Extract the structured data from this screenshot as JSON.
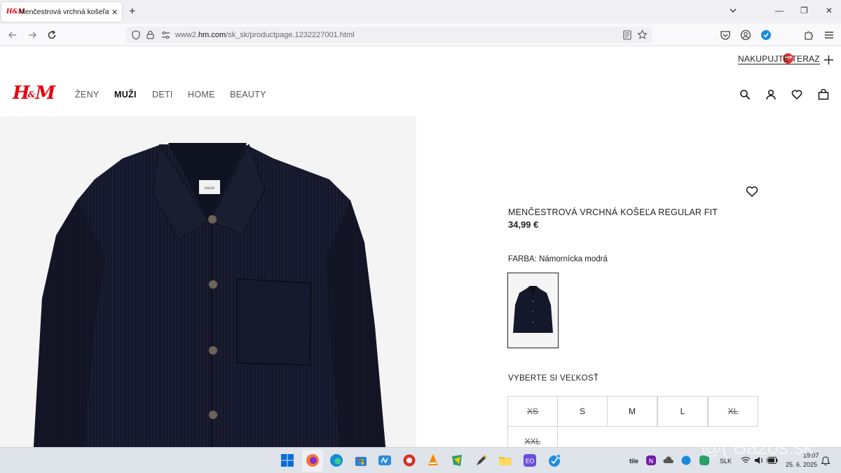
{
  "browser": {
    "tab_favicon": "H&M",
    "tab_title": "Menčestrová vrchná košeľa Reg",
    "tab_close": "✕",
    "new_tab": "+",
    "url_domain_prefix": "www2.",
    "url_domain": "hm.com",
    "url_path": "/sk_sk/productpage.1232227001.html",
    "win_minimize": "—",
    "win_restore": "❐",
    "win_close": "✕"
  },
  "header": {
    "shop_now_label": "NAKUPUJTE TERAZ",
    "logo": "H",
    "logo_amp": "&",
    "logo_m": "M",
    "menu": [
      {
        "label": "ŽENY"
      },
      {
        "label": "MUŽI"
      },
      {
        "label": "DETI"
      },
      {
        "label": "HOME"
      },
      {
        "label": "BEAUTY"
      }
    ]
  },
  "product": {
    "name": "MENČESTROVÁ VRCHNÁ KOŠEĽA REGULAR FIT",
    "price": "34,99 €",
    "color_prefix": "FARBA: ",
    "color_value": "Námornícka modrá",
    "size_heading": "VYBERTE SI VEĽKOSŤ",
    "sizes": [
      {
        "label": "XS",
        "available": false
      },
      {
        "label": "S",
        "available": true
      },
      {
        "label": "M",
        "available": true
      },
      {
        "label": "L",
        "available": true
      },
      {
        "label": "XL",
        "available": false
      },
      {
        "label": "XXL",
        "available": false
      }
    ],
    "label_tag": "H&M"
  },
  "taskbar": {
    "tray_lang": "SLK",
    "tray_time": "19:07",
    "tray_date": "25. 6. 2025",
    "tile_label": "tile"
  },
  "watermark": "@( Bazos.sk",
  "colors": {
    "brand_red": "#e50010",
    "shirt_navy": "#15182a"
  }
}
